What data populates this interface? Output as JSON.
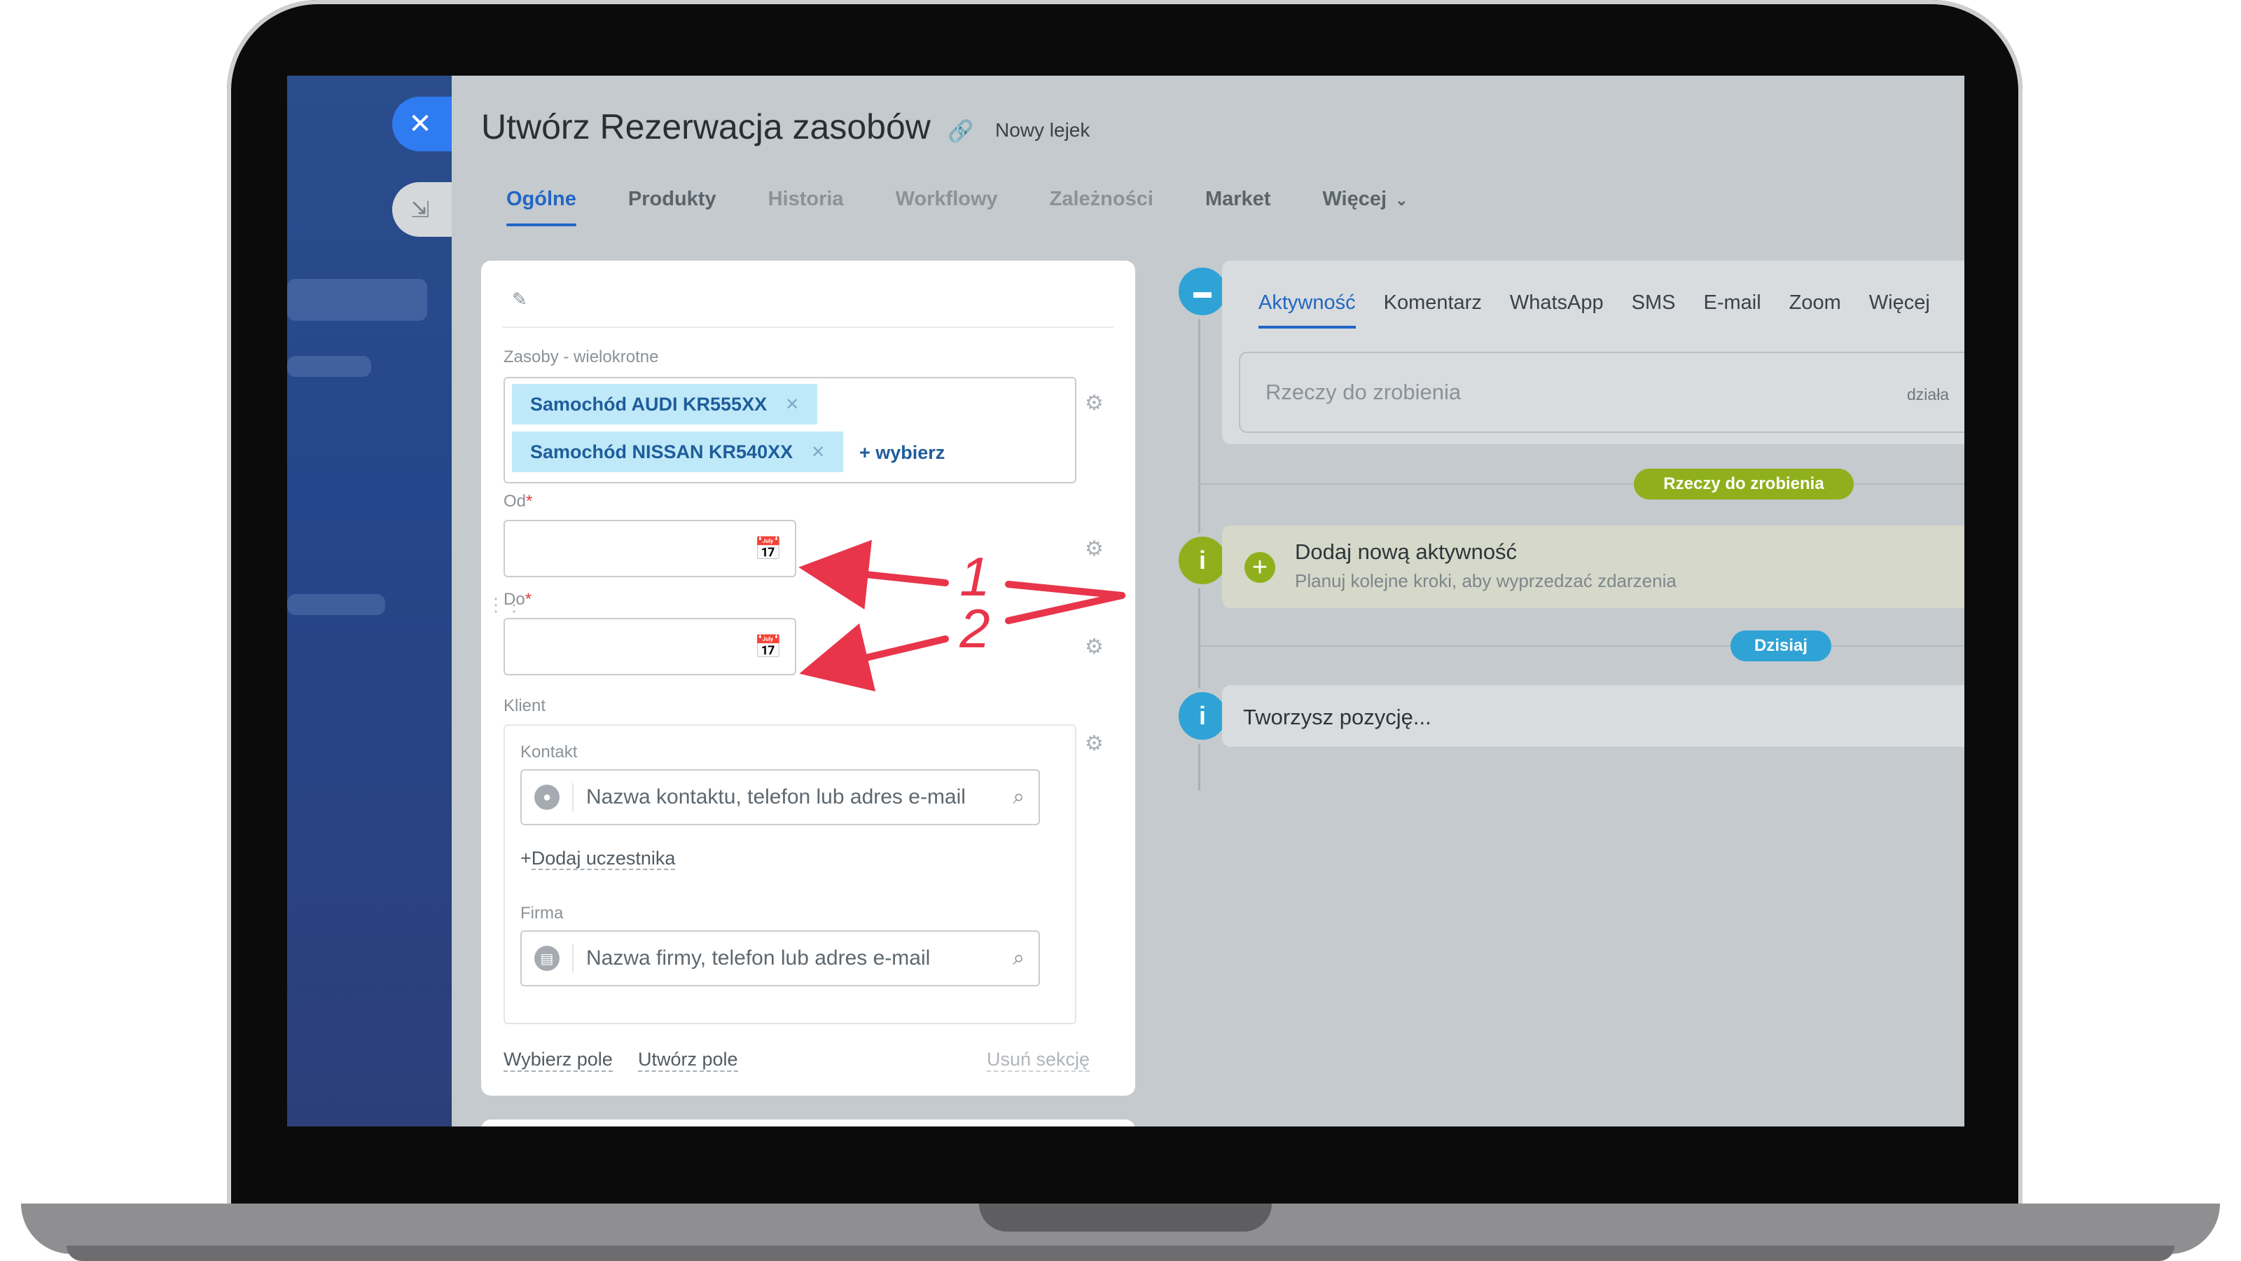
{
  "window": {
    "title": "Utwórz Rezerwacja zasobów",
    "funnel": "Nowy lejek"
  },
  "tabs": [
    {
      "label": "Ogólne",
      "state": "active"
    },
    {
      "label": "Produkty",
      "state": "normal"
    },
    {
      "label": "Historia",
      "state": "dim"
    },
    {
      "label": "Workflowy",
      "state": "dim"
    },
    {
      "label": "Zależności",
      "state": "dim"
    },
    {
      "label": "Market",
      "state": "normal"
    },
    {
      "label": "Więcej",
      "state": "normal"
    }
  ],
  "form": {
    "resources_label": "Zasoby - wielokrotne",
    "chips": [
      "Samochód AUDI KR555XX",
      "Samochód NISSAN KR540XX"
    ],
    "add_label": "+ wybierz",
    "from_label": "Od",
    "to_label": "Do",
    "required_mark": "*",
    "client_label": "Klient",
    "contact_label": "Kontakt",
    "contact_placeholder": "Nazwa kontaktu, telefon lub adres e-mail",
    "add_participant": "Dodaj uczestnika",
    "add_participant_prefix": "+",
    "company_label": "Firma",
    "company_placeholder": "Nazwa firmy, telefon lub adres e-mail",
    "select_field": "Wybierz pole",
    "create_field": "Utwórz pole",
    "delete_section": "Usuń sekcję"
  },
  "activity": {
    "tabs": [
      "Aktywność",
      "Komentarz",
      "WhatsApp",
      "SMS",
      "E-mail",
      "Zoom",
      "Więcej"
    ],
    "todo_placeholder": "Rzeczy do zrobienia",
    "todo_right": "działa",
    "todo_pill": "Rzeczy do zrobienia",
    "new_title": "Dodaj nową aktywność",
    "new_subtitle": "Planuj kolejne kroki, aby wyprzedzać zdarzenia",
    "today_pill": "Dzisiaj",
    "creating": "Tworzysz pozycję..."
  },
  "annotations": {
    "one": "1",
    "two": "2"
  },
  "colors": {
    "accent": "#2166c4",
    "green": "#8fb01c",
    "info_blue": "#2fa3d6",
    "annotation": "#e8354a"
  }
}
